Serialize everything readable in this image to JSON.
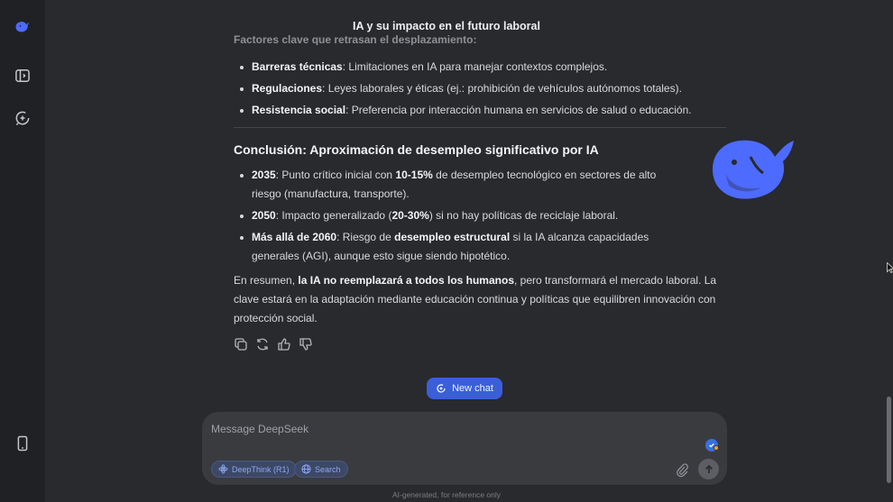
{
  "app": {
    "title": "IA y su impacto en el futuro laboral"
  },
  "sidebar": {
    "items": [
      {
        "name": "deepseek-logo-icon"
      },
      {
        "name": "sidebar-toggle-icon"
      },
      {
        "name": "new-chat-icon"
      },
      {
        "name": "mobile-app-icon"
      }
    ]
  },
  "message": {
    "faded_heading": "Factores clave que retrasan el desplazamiento:",
    "factors": [
      {
        "bold": "Barreras técnicas",
        "text": ": Limitaciones en IA para manejar contextos complejos."
      },
      {
        "bold": "Regulaciones",
        "text": ": Leyes laborales y éticas (ej.: prohibición de vehículos autónomos totales)."
      },
      {
        "bold": "Resistencia social",
        "text": ": Preferencia por interacción humana en servicios de salud o educación."
      }
    ],
    "conclusion_heading": "Conclusión: Aproximación de desempleo significativo por IA",
    "timeline": [
      {
        "year": "2035",
        "t1": ": Punto crítico inicial con ",
        "b1": "10-15%",
        "t2": " de desempleo tecnológico en sectores de alto riesgo (manufactura, transporte)."
      },
      {
        "year": "2050",
        "t1": ": Impacto generalizado (",
        "b1": "20-30%",
        "t2": ") si no hay políticas de reciclaje laboral."
      },
      {
        "year": "Más allá de 2060",
        "t1": ": Riesgo de ",
        "b1": "desempleo estructural",
        "t2": " si la IA alcanza capacidades generales (AGI), aunque esto sigue siendo hipotético."
      }
    ],
    "summary": {
      "pre": "En resumen, ",
      "bold": "la IA no reemplazará a todos los humanos",
      "post": ", pero transformará el mercado laboral. La clave estará en la adaptación mediante educación continua y políticas que equilibren innovación con protección social."
    }
  },
  "actions": [
    "copy-icon",
    "regenerate-icon",
    "thumbs-up-icon",
    "thumbs-down-icon"
  ],
  "new_chat_label": "New chat",
  "composer": {
    "placeholder": "Message DeepSeek",
    "deepthink_label": "DeepThink (R1)",
    "search_label": "Search"
  },
  "disclaimer": "AI-generated, for reference only",
  "colors": {
    "accent": "#3a5fd9",
    "whale": "#4d6bfe",
    "background": "#292a2d",
    "sidebar": "#202124"
  }
}
